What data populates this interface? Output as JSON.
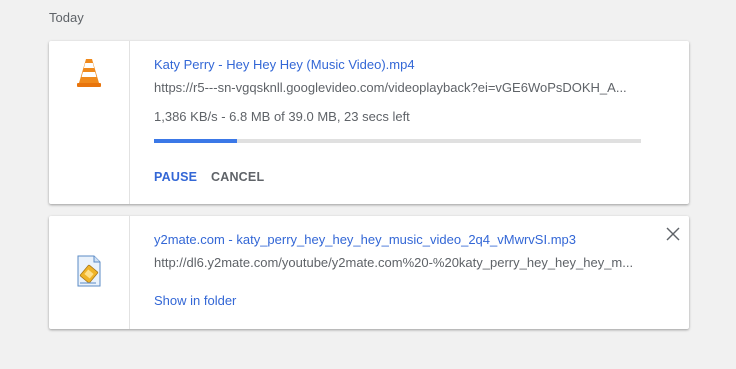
{
  "section": {
    "label": "Today"
  },
  "downloads": [
    {
      "icon": "vlc-cone-icon",
      "filename": "Katy Perry - Hey Hey Hey (Music Video).mp4",
      "url": "https://r5---sn-vgqsknll.googlevideo.com/videoplayback?ei=vGE6WoPsDOKH_A...",
      "status": "1,386 KB/s - 6.8 MB of 39.0 MB, 23 secs left",
      "progress_fraction": 0.17,
      "actions": {
        "pause": "PAUSE",
        "cancel": "CANCEL"
      }
    },
    {
      "icon": "audio-file-icon",
      "filename": "y2mate.com - katy_perry_hey_hey_hey_music_video_2q4_vMwrvSI.mp3",
      "url": "http://dl6.y2mate.com/youtube/y2mate.com%20-%20katy_perry_hey_hey_hey_m...",
      "show_in_folder": "Show in folder",
      "close_icon": "close-icon"
    }
  ],
  "colors": {
    "link_blue": "#3367d6",
    "progress_blue": "#3b78e7",
    "background": "#f1f1f1"
  }
}
